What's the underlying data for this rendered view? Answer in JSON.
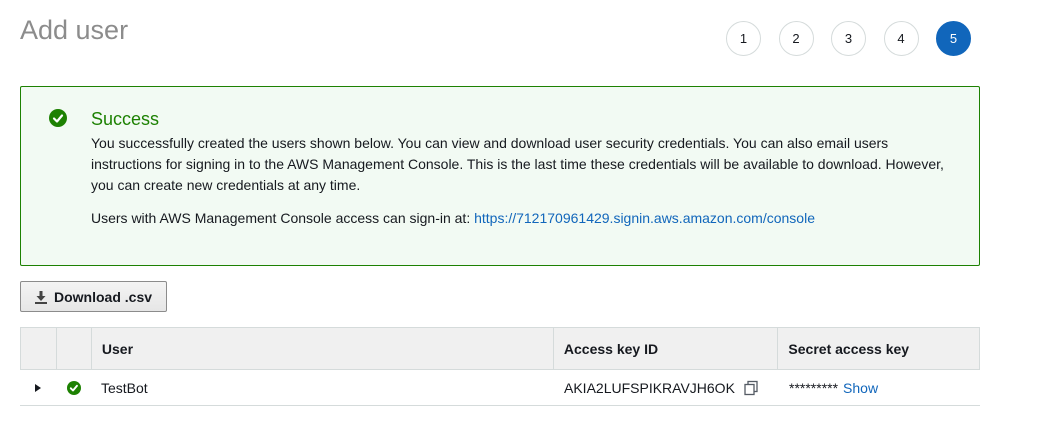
{
  "page": {
    "title": "Add user"
  },
  "steps": [
    "1",
    "2",
    "3",
    "4",
    "5"
  ],
  "active_step": "5",
  "alert": {
    "title": "Success",
    "body": "You successfully created the users shown below. You can view and download user security credentials. You can also email users instructions for signing in to the AWS Management Console. This is the last time these credentials will be available to download. However, you can create new credentials at any time.",
    "signin_prefix": "Users with AWS Management Console access can sign-in at:",
    "signin_url": "https://712170961429.signin.aws.amazon.com/console",
    "icon": "check-circle-icon",
    "color": "#1d8102",
    "background": "#f2faf3"
  },
  "actions": {
    "download_label": "Download .csv",
    "download_icon": "download-icon"
  },
  "table": {
    "headers": {
      "user": "User",
      "access_key_id": "Access key ID",
      "secret_access_key": "Secret access key"
    },
    "rows": [
      {
        "user": "TestBot",
        "access_key_id": "AKIA2LUFSPIKRAVJH6OK",
        "secret_masked": "*********",
        "show_label": "Show"
      }
    ]
  },
  "colors": {
    "accent": "#1166bb",
    "success": "#1d8102",
    "title_gray": "#8c8c8c"
  }
}
